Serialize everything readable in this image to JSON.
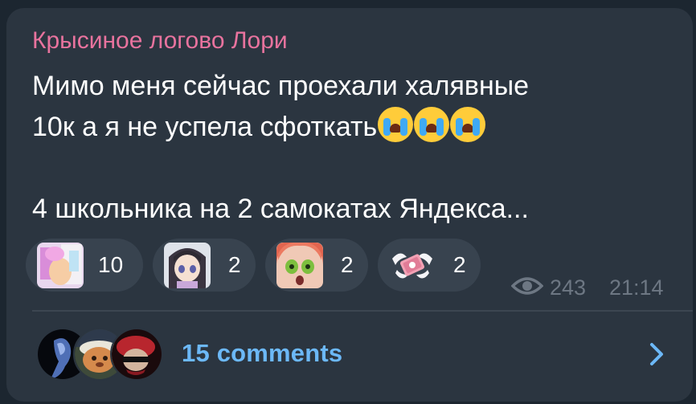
{
  "post": {
    "channel_name": "Крысиное логово Лори",
    "text_line1": "Мимо меня сейчас проехали халявные",
    "text_line2": "10к а я не успела сфоткать",
    "text_line4": "4 школьника на 2 самокатах Яндекса..."
  },
  "reactions": [
    {
      "count": "10",
      "icon": "anime-sticker-pink-icon"
    },
    {
      "count": "2",
      "icon": "anime-girl-sticker-icon"
    },
    {
      "count": "2",
      "icon": "anime-girl-shocked-sticker-icon"
    },
    {
      "count": "2",
      "icon": "winged-money-sticker-icon"
    }
  ],
  "meta": {
    "views": "243",
    "time": "21:14"
  },
  "comments": {
    "label": "15 comments"
  },
  "colors": {
    "channel_name": "#e8739e",
    "link": "#6cb8f7",
    "bubble": "#2b3540"
  }
}
